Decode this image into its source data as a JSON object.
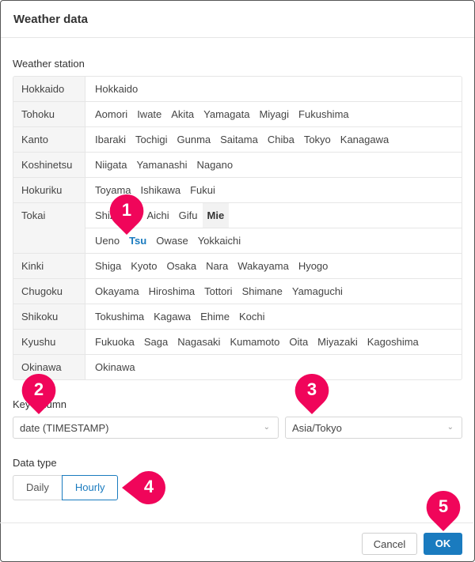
{
  "dialog": {
    "title": "Weather data"
  },
  "weather_station": {
    "label": "Weather station",
    "regions": [
      {
        "name": "Hokkaido",
        "lines": [
          [
            {
              "label": "Hokkaido"
            }
          ]
        ]
      },
      {
        "name": "Tohoku",
        "lines": [
          [
            {
              "label": "Aomori"
            },
            {
              "label": "Iwate"
            },
            {
              "label": "Akita"
            },
            {
              "label": "Yamagata"
            },
            {
              "label": "Miyagi"
            },
            {
              "label": "Fukushima"
            }
          ]
        ]
      },
      {
        "name": "Kanto",
        "lines": [
          [
            {
              "label": "Ibaraki"
            },
            {
              "label": "Tochigi"
            },
            {
              "label": "Gunma"
            },
            {
              "label": "Saitama"
            },
            {
              "label": "Chiba"
            },
            {
              "label": "Tokyo"
            },
            {
              "label": "Kanagawa"
            }
          ]
        ]
      },
      {
        "name": "Koshinetsu",
        "lines": [
          [
            {
              "label": "Niigata"
            },
            {
              "label": "Yamanashi"
            },
            {
              "label": "Nagano"
            }
          ]
        ]
      },
      {
        "name": "Hokuriku",
        "lines": [
          [
            {
              "label": "Toyama"
            },
            {
              "label": "Ishikawa"
            },
            {
              "label": "Fukui"
            }
          ]
        ]
      },
      {
        "name": "Tokai",
        "lines": [
          [
            {
              "label": "Shizuoka"
            },
            {
              "label": "Aichi"
            },
            {
              "label": "Gifu"
            },
            {
              "label": "Mie",
              "state": "expanded"
            }
          ],
          [
            {
              "label": "Ueno"
            },
            {
              "label": "Tsu",
              "state": "selected"
            },
            {
              "label": "Owase"
            },
            {
              "label": "Yokkaichi"
            }
          ]
        ]
      },
      {
        "name": "Kinki",
        "lines": [
          [
            {
              "label": "Shiga"
            },
            {
              "label": "Kyoto"
            },
            {
              "label": "Osaka"
            },
            {
              "label": "Nara"
            },
            {
              "label": "Wakayama"
            },
            {
              "label": "Hyogo"
            }
          ]
        ]
      },
      {
        "name": "Chugoku",
        "lines": [
          [
            {
              "label": "Okayama"
            },
            {
              "label": "Hiroshima"
            },
            {
              "label": "Tottori"
            },
            {
              "label": "Shimane"
            },
            {
              "label": "Yamaguchi"
            }
          ]
        ]
      },
      {
        "name": "Shikoku",
        "lines": [
          [
            {
              "label": "Tokushima"
            },
            {
              "label": "Kagawa"
            },
            {
              "label": "Ehime"
            },
            {
              "label": "Kochi"
            }
          ]
        ]
      },
      {
        "name": "Kyushu",
        "lines": [
          [
            {
              "label": "Fukuoka"
            },
            {
              "label": "Saga"
            },
            {
              "label": "Nagasaki"
            },
            {
              "label": "Kumamoto"
            },
            {
              "label": "Oita"
            },
            {
              "label": "Miyazaki"
            },
            {
              "label": "Kagoshima"
            }
          ]
        ]
      },
      {
        "name": "Okinawa",
        "lines": [
          [
            {
              "label": "Okinawa"
            }
          ]
        ]
      }
    ]
  },
  "key_column": {
    "label": "Key column",
    "value": "date (TIMESTAMP)",
    "timezone": "Asia/Tokyo"
  },
  "data_type": {
    "label": "Data type",
    "options": [
      "Daily",
      "Hourly"
    ],
    "selected": "Hourly"
  },
  "buttons": {
    "cancel": "Cancel",
    "ok": "OK"
  },
  "markers": [
    "1",
    "2",
    "3",
    "4",
    "5"
  ],
  "colors": {
    "accent": "#1a7bbf",
    "marker": "#f0055a"
  }
}
